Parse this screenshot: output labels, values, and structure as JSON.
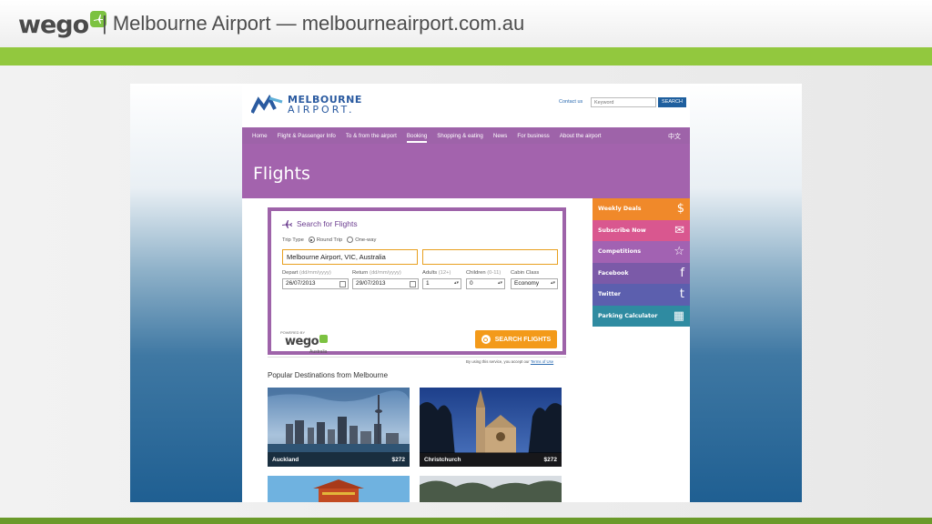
{
  "slide": {
    "brand": "wego",
    "title": "| Melbourne Airport — melbourneairport.com.au"
  },
  "site": {
    "logo_line1": "MELBOURNE",
    "logo_line2": "AIRPORT.",
    "contact_link": "Contact us",
    "keyword_placeholder": "Keyword",
    "search_button": "SEARCH",
    "nav": [
      "Home",
      "Flight & Passenger Info",
      "To & from the airport",
      "Booking",
      "Shopping & eating",
      "News",
      "For business",
      "About the airport"
    ],
    "nav_active": "Booking",
    "nav_lang": "中文",
    "page_title": "Flights"
  },
  "search": {
    "title": "Search for Flights",
    "trip_type_label": "Trip Type",
    "round_trip": "Round Trip",
    "one_way": "One-way",
    "trip_selected": "Round Trip",
    "from_value": "Melbourne Airport, VIC, Australia",
    "to_value": "",
    "depart_label": "Depart",
    "depart_hint": "(dd/mm/yyyy)",
    "depart_value": "26/07/2013",
    "return_label": "Return",
    "return_hint": "(dd/mm/yyyy)",
    "return_value": "29/07/2013",
    "adults_label": "Adults",
    "adults_hint": "(12+)",
    "adults_value": "1",
    "children_label": "Children",
    "children_hint": "(0-11)",
    "children_value": "0",
    "cabin_label": "Cabin Class",
    "cabin_value": "Economy",
    "powered_by": "POWERED BY",
    "powered_brand": "wego",
    "powered_region": "Australia",
    "button": "SEARCH FLIGHTS",
    "terms_prefix": "By using this service, you accept our",
    "terms_link": "Terms of Use"
  },
  "popular": {
    "title": "Popular Destinations from Melbourne",
    "destinations": [
      {
        "city": "Auckland",
        "price": "$272"
      },
      {
        "city": "Christchurch",
        "price": "$272"
      }
    ]
  },
  "side": [
    {
      "label": "Weekly Deals",
      "icon": "dollar-icon",
      "color": "#f0892a"
    },
    {
      "label": "Subscribe Now",
      "icon": "envelope-icon",
      "color": "#d9578f"
    },
    {
      "label": "Competitions",
      "icon": "star-icon",
      "color": "#a262b2"
    },
    {
      "label": "Facebook",
      "icon": "facebook-icon",
      "color": "#7b5aa8"
    },
    {
      "label": "Twitter",
      "icon": "twitter-icon",
      "color": "#5c5fae"
    },
    {
      "label": "Parking Calculator",
      "icon": "calculator-icon",
      "color": "#2f8ba1"
    }
  ],
  "colors": {
    "accent_green": "#92c83e",
    "site_purple": "#9e63a9",
    "search_orange": "#f39a1a"
  }
}
